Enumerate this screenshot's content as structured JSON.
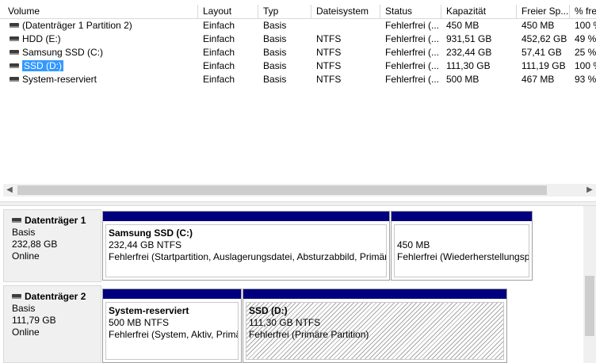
{
  "table": {
    "headers": [
      "Volume",
      "Layout",
      "Typ",
      "Dateisystem",
      "Status",
      "Kapazität",
      "Freier Sp...",
      "% fre"
    ],
    "rows": [
      {
        "volume": "(Datenträger 1 Partition 2)",
        "layout": "Einfach",
        "typ": "Basis",
        "fs": "",
        "status": "Fehlerfrei (...",
        "cap": "450 MB",
        "free": "450 MB",
        "pct": "100 %"
      },
      {
        "volume": "HDD (E:)",
        "layout": "Einfach",
        "typ": "Basis",
        "fs": "NTFS",
        "status": "Fehlerfrei (...",
        "cap": "931,51 GB",
        "free": "452,62 GB",
        "pct": "49 %"
      },
      {
        "volume": "Samsung SSD (C:)",
        "layout": "Einfach",
        "typ": "Basis",
        "fs": "NTFS",
        "status": "Fehlerfrei (...",
        "cap": "232,44 GB",
        "free": "57,41 GB",
        "pct": "25 %"
      },
      {
        "volume": "SSD (D:)",
        "layout": "Einfach",
        "typ": "Basis",
        "fs": "NTFS",
        "status": "Fehlerfrei (...",
        "cap": "111,30 GB",
        "free": "111,19 GB",
        "pct": "100 %"
      },
      {
        "volume": "System-reserviert",
        "layout": "Einfach",
        "typ": "Basis",
        "fs": "NTFS",
        "status": "Fehlerfrei (...",
        "cap": "500 MB",
        "free": "467 MB",
        "pct": "93 %"
      }
    ]
  },
  "disks": [
    {
      "name": "Datenträger 1",
      "type": "Basis",
      "size": "232,88 GB",
      "state": "Online",
      "partitions": [
        {
          "name": "Samsung SSD  (C:)",
          "size": "232,44 GB NTFS",
          "status": "Fehlerfrei (Startpartition, Auslagerungsdatei, Absturzabbild, Primär"
        },
        {
          "name": "",
          "size": "450 MB",
          "status": "Fehlerfrei (Wiederherstellungsp"
        }
      ]
    },
    {
      "name": "Datenträger 2",
      "type": "Basis",
      "size": "111,79 GB",
      "state": "Online",
      "partitions": [
        {
          "name": "System-reserviert",
          "size": "500 MB NTFS",
          "status": "Fehlerfrei (System, Aktiv, Primä"
        },
        {
          "name": "SSD  (D:)",
          "size": "111,30 GB NTFS",
          "status": "Fehlerfrei (Primäre Partition)"
        }
      ]
    }
  ],
  "icons": {
    "disk": "disk-drive-icon",
    "scroll_left": "◀",
    "scroll_right": "▶"
  },
  "colors": {
    "partition_bar": "#00007f",
    "selection": "#3399ff"
  }
}
